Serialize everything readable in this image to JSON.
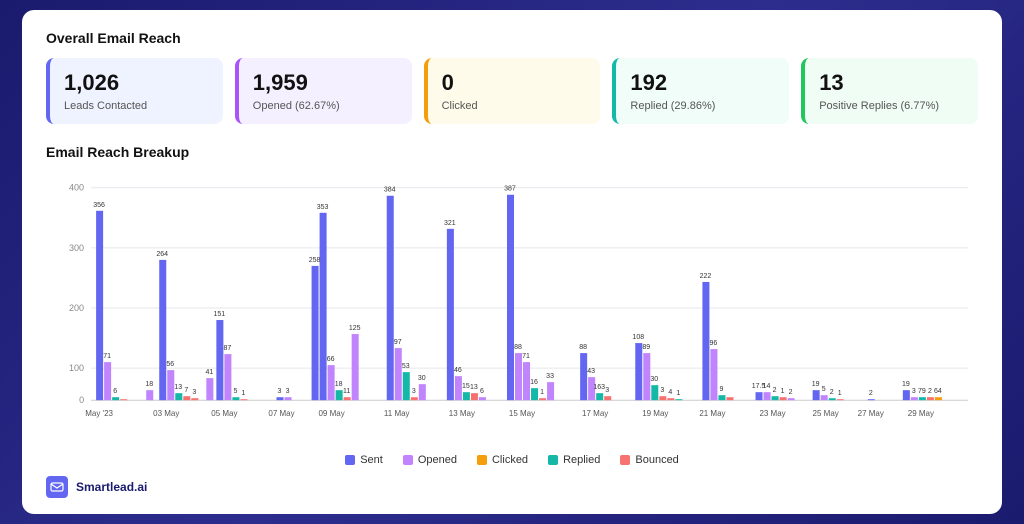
{
  "header": {
    "title": "Overall Email Reach"
  },
  "metrics": [
    {
      "id": "leads",
      "value": "1,026",
      "label": "Leads Contacted",
      "theme": "blue"
    },
    {
      "id": "opened",
      "value": "1,959",
      "label": "Opened (62.67%)",
      "theme": "purple"
    },
    {
      "id": "clicked",
      "value": "0",
      "label": "Clicked",
      "theme": "yellow"
    },
    {
      "id": "replied",
      "value": "192",
      "label": "Replied (29.86%)",
      "theme": "teal"
    },
    {
      "id": "positive",
      "value": "13",
      "label": "Positive Replies (6.77%)",
      "theme": "green"
    }
  ],
  "chart": {
    "title": "Email Reach Breakup",
    "legend": [
      {
        "label": "Sent",
        "color": "#6366f1"
      },
      {
        "label": "Opened",
        "color": "#c084fc"
      },
      {
        "label": "Clicked",
        "color": "#f59e0b"
      },
      {
        "label": "Replied",
        "color": "#14b8a6"
      },
      {
        "label": "Bounced",
        "color": "#f87171"
      }
    ]
  },
  "footer": {
    "logo_text": "Smartlead.ai"
  }
}
